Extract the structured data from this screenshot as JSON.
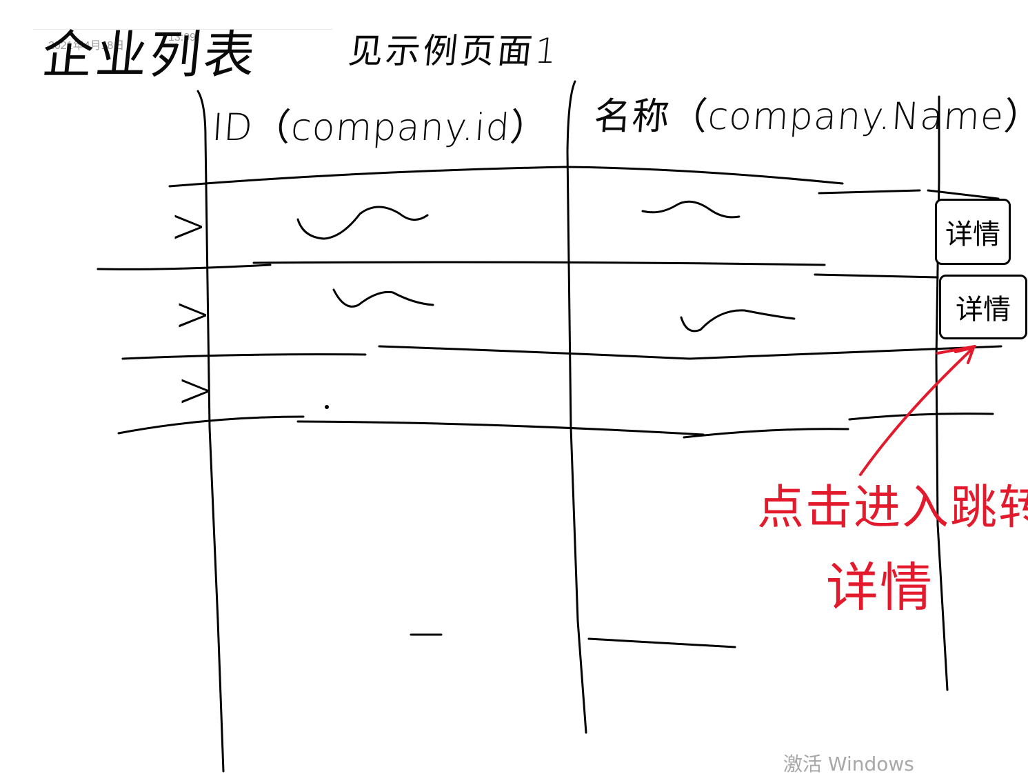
{
  "meta": {
    "date": "2021年4月18日",
    "time": "13:09"
  },
  "title": "企业列表",
  "subtitle": "见示例页面1",
  "table": {
    "columns": [
      "ID（company.id）",
      "名称（company.Name）"
    ],
    "rows": [
      {
        "expand": ">",
        "detail": "详情"
      },
      {
        "expand": ">",
        "detail": "详情"
      },
      {
        "expand": ">"
      }
    ]
  },
  "annotation": {
    "line1": "点击进入跳转",
    "line2": "详情",
    "color": "#e3192c"
  },
  "watermark": "激活 Windows"
}
